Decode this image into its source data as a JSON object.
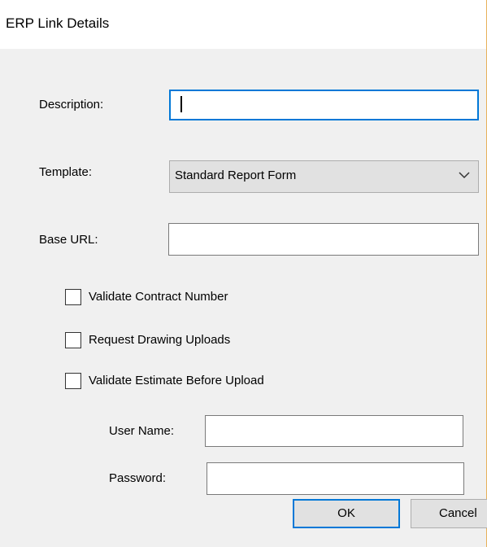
{
  "window": {
    "title": "ERP Link Details"
  },
  "form": {
    "description": {
      "label": "Description:",
      "value": ""
    },
    "template": {
      "label": "Template:",
      "value": "Standard Report Form"
    },
    "base_url": {
      "label": "Base URL:",
      "value": ""
    },
    "checkboxes": [
      {
        "label": "Validate Contract Number",
        "checked": false
      },
      {
        "label": "Request Drawing Uploads",
        "checked": false
      },
      {
        "label": "Validate Estimate Before Upload",
        "checked": false
      }
    ],
    "user_name": {
      "label": "User Name:",
      "value": ""
    },
    "password": {
      "label": "Password:",
      "value": ""
    }
  },
  "buttons": {
    "ok": "OK",
    "cancel": "Cancel"
  },
  "colors": {
    "focus_border": "#0078d7",
    "window_bg": "#f0f0f0",
    "title_bg": "#ffffff"
  },
  "icons": {
    "dropdown": "chevron-down-icon"
  }
}
